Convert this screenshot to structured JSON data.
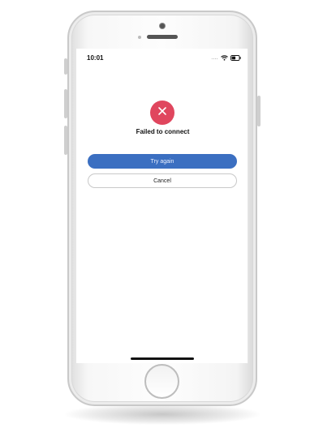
{
  "status_bar": {
    "time": "10:01",
    "signal": "....",
    "icons": [
      "wifi-icon",
      "battery-icon"
    ]
  },
  "dialog": {
    "icon": "close-x-icon",
    "title": "Failed to connect",
    "primary_button": "Try again",
    "secondary_button": "Cancel"
  },
  "colors": {
    "error_badge": "#e0465e",
    "primary_button": "#3b6fc1"
  }
}
